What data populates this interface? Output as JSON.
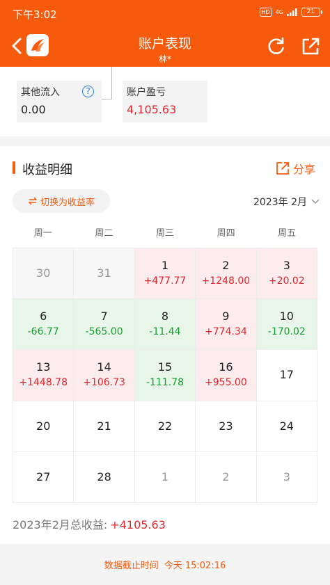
{
  "status_bar": {
    "time": "下午3:02",
    "hd": "HD",
    "network": "4G",
    "battery": "21"
  },
  "header": {
    "title": "账户表现",
    "subtitle": "林*"
  },
  "metrics": [
    {
      "label": "其他流入",
      "value": "0.00"
    },
    {
      "label": "账户盈亏",
      "value": "4,105.63"
    }
  ],
  "detail": {
    "title": "收益明细",
    "share_label": "分享",
    "switch_label": "切换为收益率",
    "month": "2023年 2月",
    "weekdays": [
      "周一",
      "周二",
      "周三",
      "周四",
      "周五"
    ],
    "calendar": [
      {
        "day": "30",
        "amount": "",
        "state": "other"
      },
      {
        "day": "31",
        "amount": "",
        "state": "other"
      },
      {
        "day": "1",
        "amount": "+477.77",
        "state": "up"
      },
      {
        "day": "2",
        "amount": "+1248.00",
        "state": "up"
      },
      {
        "day": "3",
        "amount": "+20.02",
        "state": "up"
      },
      {
        "day": "6",
        "amount": "-66.77",
        "state": "down"
      },
      {
        "day": "7",
        "amount": "-565.00",
        "state": "down"
      },
      {
        "day": "8",
        "amount": "-11.44",
        "state": "down"
      },
      {
        "day": "9",
        "amount": "+774.34",
        "state": "up"
      },
      {
        "day": "10",
        "amount": "-170.02",
        "state": "down"
      },
      {
        "day": "13",
        "amount": "+1448.78",
        "state": "up"
      },
      {
        "day": "14",
        "amount": "+106.73",
        "state": "up"
      },
      {
        "day": "15",
        "amount": "-111.78",
        "state": "down"
      },
      {
        "day": "16",
        "amount": "+955.00",
        "state": "up"
      },
      {
        "day": "17",
        "amount": "",
        "state": "none"
      },
      {
        "day": "20",
        "amount": "",
        "state": "none"
      },
      {
        "day": "21",
        "amount": "",
        "state": "none"
      },
      {
        "day": "22",
        "amount": "",
        "state": "none"
      },
      {
        "day": "23",
        "amount": "",
        "state": "none"
      },
      {
        "day": "24",
        "amount": "",
        "state": "none"
      },
      {
        "day": "27",
        "amount": "",
        "state": "none"
      },
      {
        "day": "28",
        "amount": "",
        "state": "none"
      },
      {
        "day": "1",
        "amount": "",
        "state": "dim"
      },
      {
        "day": "2",
        "amount": "",
        "state": "dim"
      },
      {
        "day": "3",
        "amount": "",
        "state": "dim"
      }
    ],
    "total_label": "2023年2月总收益:",
    "total_value": "+4105.63"
  },
  "footer": {
    "label": "数据截止时间",
    "value": "今天 15:02:16"
  },
  "colors": {
    "brand": "#f65a0c",
    "gain": "#e0262c",
    "loss": "#159c2e"
  },
  "icons": [
    "back-arrow-icon",
    "app-logo-icon",
    "refresh-icon",
    "open-external-icon",
    "help-icon",
    "share-icon",
    "swap-icon",
    "chevron-down-icon"
  ]
}
